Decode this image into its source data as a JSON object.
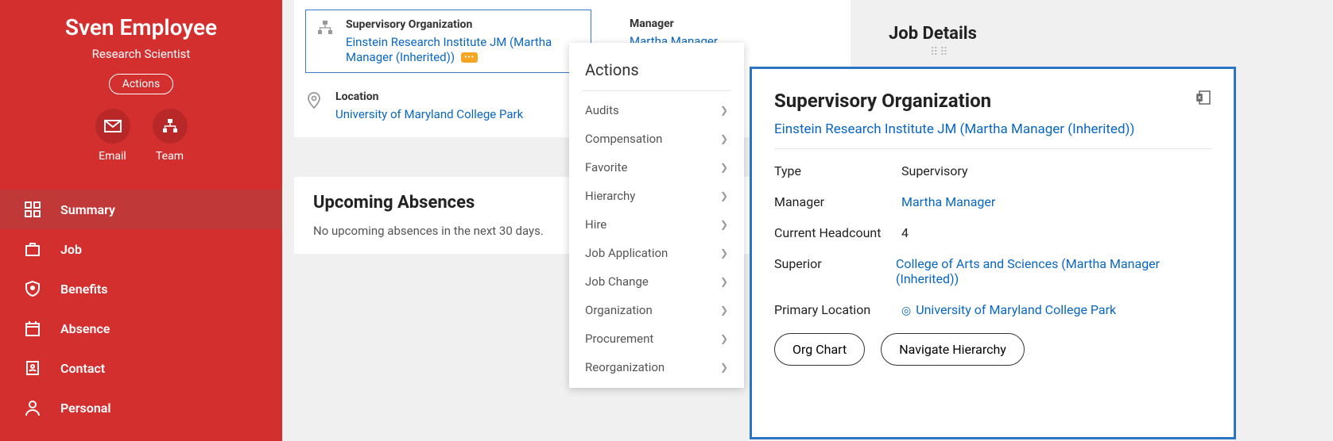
{
  "sidebar": {
    "name": "Sven Employee",
    "title": "Research Scientist",
    "actions_label": "Actions",
    "icon_email": "Email",
    "icon_team": "Team",
    "nav": [
      {
        "label": "Summary"
      },
      {
        "label": "Job"
      },
      {
        "label": "Benefits"
      },
      {
        "label": "Absence"
      },
      {
        "label": "Contact"
      },
      {
        "label": "Personal"
      }
    ]
  },
  "main": {
    "sup_org_label": "Supervisory Organization",
    "sup_org_value": "Einstein Research Institute JM (Martha Manager (Inherited))",
    "manager_label": "Manager",
    "manager_value": "Martha Manager",
    "location_label": "Location",
    "location_value": "University of Maryland College Park",
    "absences_title": "Upcoming Absences",
    "absences_empty": "No upcoming absences in the next 30 days."
  },
  "job_details_heading": "Job Details",
  "actions_menu": {
    "title": "Actions",
    "items": [
      "Audits",
      "Compensation",
      "Favorite",
      "Hierarchy",
      "Hire",
      "Job Application",
      "Job Change",
      "Organization",
      "Procurement",
      "Reorganization"
    ]
  },
  "detail": {
    "title": "Supervisory Organization",
    "link": "Einstein Research Institute JM (Martha Manager (Inherited))",
    "rows": {
      "type_k": "Type",
      "type_v": "Supervisory",
      "manager_k": "Manager",
      "manager_v": "Martha Manager",
      "headcount_k": "Current Headcount",
      "headcount_v": "4",
      "superior_k": "Superior",
      "superior_v": "College of Arts and Sciences (Martha Manager (Inherited))",
      "primloc_k": "Primary Location",
      "primloc_v": "University of Maryland College Park"
    },
    "buttons": {
      "org_chart": "Org Chart",
      "nav_hier": "Navigate Hierarchy"
    }
  }
}
